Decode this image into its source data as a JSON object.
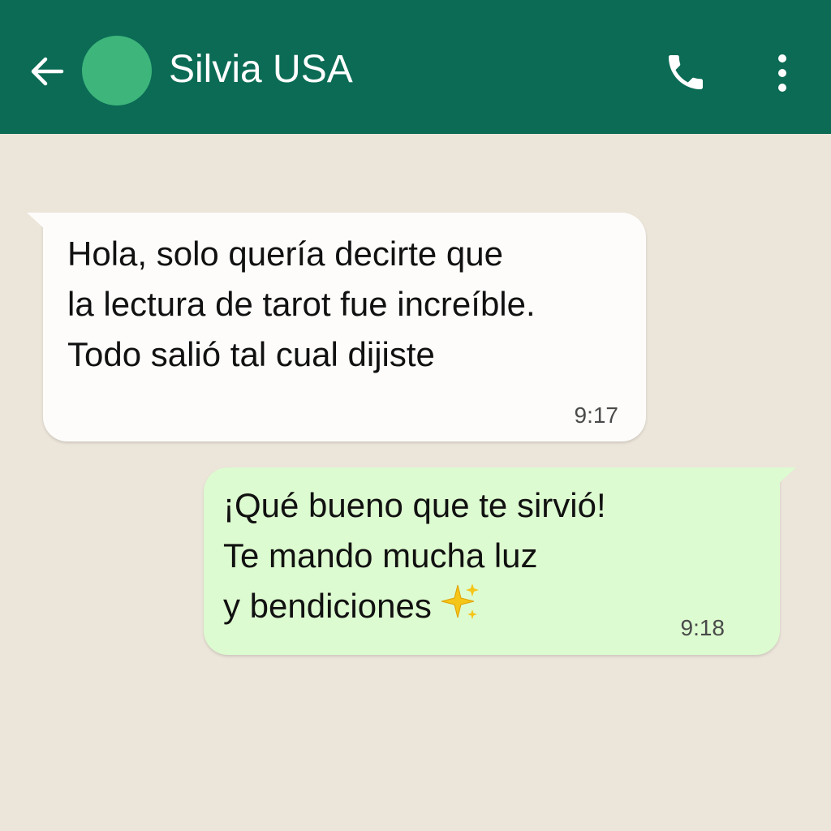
{
  "colors": {
    "header_bg": "#0B6B55",
    "avatar": "#3DB57B",
    "chat_bg": "#ECE5DA",
    "incoming_bubble": "#FDFCFA",
    "outgoing_bubble": "#DDFBD0",
    "sparkle": "#F5C518"
  },
  "header": {
    "back_icon": "arrow-left-icon",
    "contact_name": "Silvia USA",
    "call_icon": "phone-icon",
    "menu_icon": "more-vertical-icon"
  },
  "messages": [
    {
      "direction": "incoming",
      "text": "Hola, solo quería decirte que\nla lectura de tarot fue increíble.\nTodo salió tal cual dijiste",
      "time": "9:17"
    },
    {
      "direction": "outgoing",
      "text": "¡Qué bueno que te sirvió!\nTe mando mucha luz\ny bendiciones",
      "emoji": "sparkles-icon",
      "time": "9:18"
    }
  ]
}
